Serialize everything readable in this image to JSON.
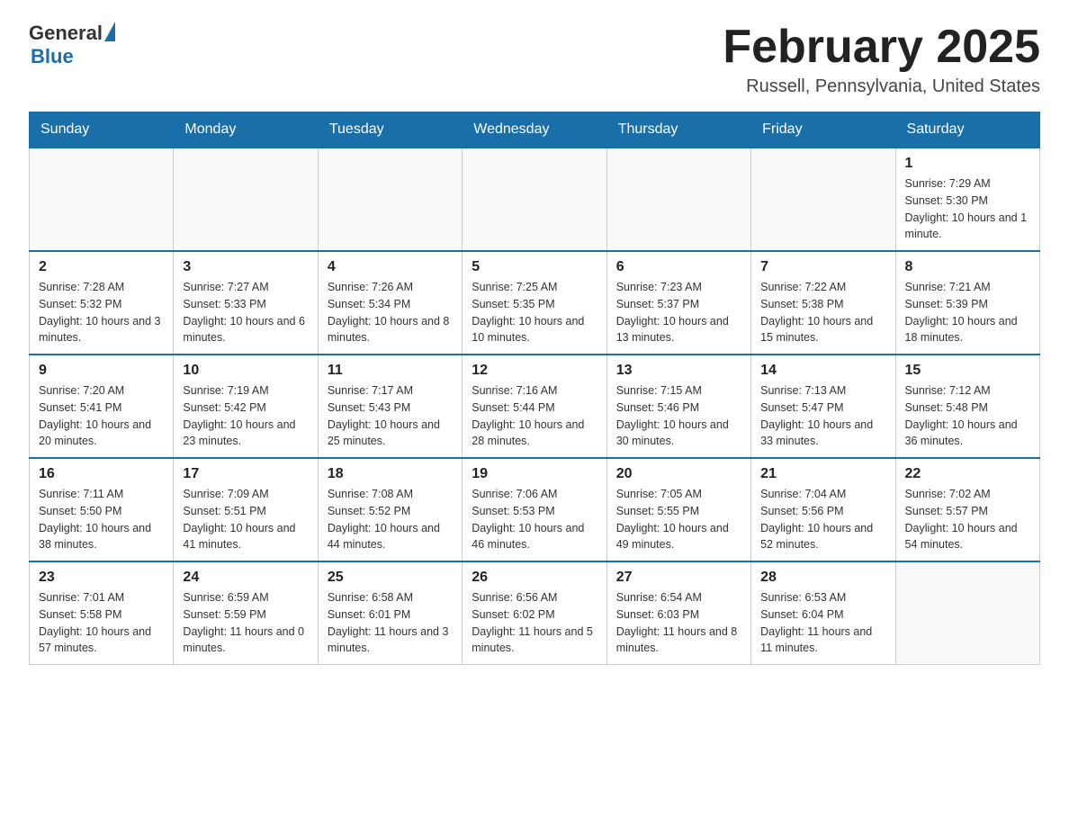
{
  "logo": {
    "general": "General",
    "blue": "Blue"
  },
  "title": "February 2025",
  "location": "Russell, Pennsylvania, United States",
  "days_of_week": [
    "Sunday",
    "Monday",
    "Tuesday",
    "Wednesday",
    "Thursday",
    "Friday",
    "Saturday"
  ],
  "weeks": [
    [
      {
        "day": "",
        "info": ""
      },
      {
        "day": "",
        "info": ""
      },
      {
        "day": "",
        "info": ""
      },
      {
        "day": "",
        "info": ""
      },
      {
        "day": "",
        "info": ""
      },
      {
        "day": "",
        "info": ""
      },
      {
        "day": "1",
        "info": "Sunrise: 7:29 AM\nSunset: 5:30 PM\nDaylight: 10 hours and 1 minute."
      }
    ],
    [
      {
        "day": "2",
        "info": "Sunrise: 7:28 AM\nSunset: 5:32 PM\nDaylight: 10 hours and 3 minutes."
      },
      {
        "day": "3",
        "info": "Sunrise: 7:27 AM\nSunset: 5:33 PM\nDaylight: 10 hours and 6 minutes."
      },
      {
        "day": "4",
        "info": "Sunrise: 7:26 AM\nSunset: 5:34 PM\nDaylight: 10 hours and 8 minutes."
      },
      {
        "day": "5",
        "info": "Sunrise: 7:25 AM\nSunset: 5:35 PM\nDaylight: 10 hours and 10 minutes."
      },
      {
        "day": "6",
        "info": "Sunrise: 7:23 AM\nSunset: 5:37 PM\nDaylight: 10 hours and 13 minutes."
      },
      {
        "day": "7",
        "info": "Sunrise: 7:22 AM\nSunset: 5:38 PM\nDaylight: 10 hours and 15 minutes."
      },
      {
        "day": "8",
        "info": "Sunrise: 7:21 AM\nSunset: 5:39 PM\nDaylight: 10 hours and 18 minutes."
      }
    ],
    [
      {
        "day": "9",
        "info": "Sunrise: 7:20 AM\nSunset: 5:41 PM\nDaylight: 10 hours and 20 minutes."
      },
      {
        "day": "10",
        "info": "Sunrise: 7:19 AM\nSunset: 5:42 PM\nDaylight: 10 hours and 23 minutes."
      },
      {
        "day": "11",
        "info": "Sunrise: 7:17 AM\nSunset: 5:43 PM\nDaylight: 10 hours and 25 minutes."
      },
      {
        "day": "12",
        "info": "Sunrise: 7:16 AM\nSunset: 5:44 PM\nDaylight: 10 hours and 28 minutes."
      },
      {
        "day": "13",
        "info": "Sunrise: 7:15 AM\nSunset: 5:46 PM\nDaylight: 10 hours and 30 minutes."
      },
      {
        "day": "14",
        "info": "Sunrise: 7:13 AM\nSunset: 5:47 PM\nDaylight: 10 hours and 33 minutes."
      },
      {
        "day": "15",
        "info": "Sunrise: 7:12 AM\nSunset: 5:48 PM\nDaylight: 10 hours and 36 minutes."
      }
    ],
    [
      {
        "day": "16",
        "info": "Sunrise: 7:11 AM\nSunset: 5:50 PM\nDaylight: 10 hours and 38 minutes."
      },
      {
        "day": "17",
        "info": "Sunrise: 7:09 AM\nSunset: 5:51 PM\nDaylight: 10 hours and 41 minutes."
      },
      {
        "day": "18",
        "info": "Sunrise: 7:08 AM\nSunset: 5:52 PM\nDaylight: 10 hours and 44 minutes."
      },
      {
        "day": "19",
        "info": "Sunrise: 7:06 AM\nSunset: 5:53 PM\nDaylight: 10 hours and 46 minutes."
      },
      {
        "day": "20",
        "info": "Sunrise: 7:05 AM\nSunset: 5:55 PM\nDaylight: 10 hours and 49 minutes."
      },
      {
        "day": "21",
        "info": "Sunrise: 7:04 AM\nSunset: 5:56 PM\nDaylight: 10 hours and 52 minutes."
      },
      {
        "day": "22",
        "info": "Sunrise: 7:02 AM\nSunset: 5:57 PM\nDaylight: 10 hours and 54 minutes."
      }
    ],
    [
      {
        "day": "23",
        "info": "Sunrise: 7:01 AM\nSunset: 5:58 PM\nDaylight: 10 hours and 57 minutes."
      },
      {
        "day": "24",
        "info": "Sunrise: 6:59 AM\nSunset: 5:59 PM\nDaylight: 11 hours and 0 minutes."
      },
      {
        "day": "25",
        "info": "Sunrise: 6:58 AM\nSunset: 6:01 PM\nDaylight: 11 hours and 3 minutes."
      },
      {
        "day": "26",
        "info": "Sunrise: 6:56 AM\nSunset: 6:02 PM\nDaylight: 11 hours and 5 minutes."
      },
      {
        "day": "27",
        "info": "Sunrise: 6:54 AM\nSunset: 6:03 PM\nDaylight: 11 hours and 8 minutes."
      },
      {
        "day": "28",
        "info": "Sunrise: 6:53 AM\nSunset: 6:04 PM\nDaylight: 11 hours and 11 minutes."
      },
      {
        "day": "",
        "info": ""
      }
    ]
  ]
}
